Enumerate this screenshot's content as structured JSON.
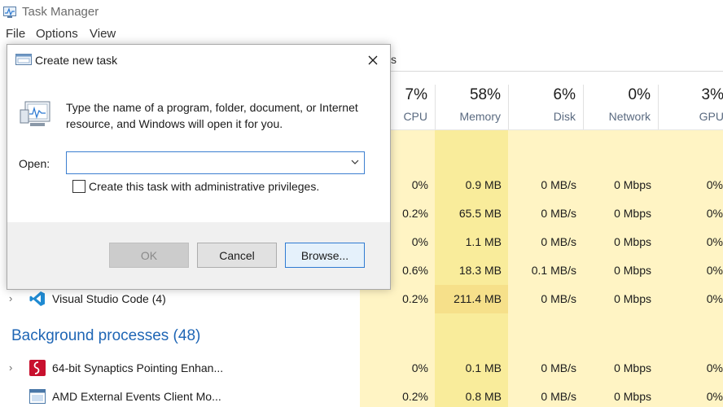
{
  "window": {
    "title": "Task Manager"
  },
  "menu": {
    "file": "File",
    "options": "Options",
    "view": "View"
  },
  "tab_fragment": "s",
  "columns": {
    "cpu": {
      "pct": "7%",
      "label": "CPU"
    },
    "memory": {
      "pct": "58%",
      "label": "Memory"
    },
    "disk": {
      "pct": "6%",
      "label": "Disk"
    },
    "network": {
      "pct": "0%",
      "label": "Network"
    },
    "gpu": {
      "pct": "3%",
      "label": "GPU"
    }
  },
  "rows": [
    {
      "name": "",
      "cpu": "0%",
      "memory": "0.9 MB",
      "disk": "0 MB/s",
      "network": "0 Mbps",
      "gpu": "0%"
    },
    {
      "name": "",
      "cpu": "0.2%",
      "memory": "65.5 MB",
      "disk": "0 MB/s",
      "network": "0 Mbps",
      "gpu": "0%"
    },
    {
      "name": "",
      "cpu": "0%",
      "memory": "1.1 MB",
      "disk": "0 MB/s",
      "network": "0 Mbps",
      "gpu": "0%"
    },
    {
      "name": "",
      "cpu": "0.6%",
      "memory": "18.3 MB",
      "disk": "0.1 MB/s",
      "network": "0 Mbps",
      "gpu": "0%"
    },
    {
      "name": "Visual Studio Code (4)",
      "cpu": "0.2%",
      "memory": "211.4 MB",
      "disk": "0 MB/s",
      "network": "0 Mbps",
      "gpu": "0%"
    }
  ],
  "background_section": {
    "title": "Background processes (48)"
  },
  "bg_rows": [
    {
      "name": "64-bit Synaptics Pointing Enhan...",
      "cpu": "0%",
      "memory": "0.1 MB",
      "disk": "0 MB/s",
      "network": "0 Mbps",
      "gpu": "0%"
    },
    {
      "name": "AMD External Events Client Mo...",
      "cpu": "0.2%",
      "memory": "0.8 MB",
      "disk": "0 MB/s",
      "network": "0 Mbps",
      "gpu": "0%"
    }
  ],
  "dialog": {
    "title": "Create new task",
    "description": "Type the name of a program, folder, document, or Internet resource, and Windows will open it for you.",
    "open_label": "Open:",
    "open_value": "",
    "admin_checkbox_label": "Create this task with administrative privileges.",
    "admin_checked": false,
    "ok_label": "OK",
    "cancel_label": "Cancel",
    "browse_label": "Browse..."
  },
  "colors": {
    "heat_light": "#fff4c4",
    "heat_medium": "#f9ec9b",
    "section_blue": "#1f66b5",
    "accent_blue": "#2f7bd2"
  },
  "icons": {
    "app": "task-manager-icon",
    "dialog": "run-icon",
    "close": "close-icon",
    "dropdown": "chevron-down-icon",
    "row_expand": "chevron-right-icon",
    "vscode": "vscode-icon",
    "synaptics": "synaptics-icon",
    "amd": "amd-app-icon"
  }
}
